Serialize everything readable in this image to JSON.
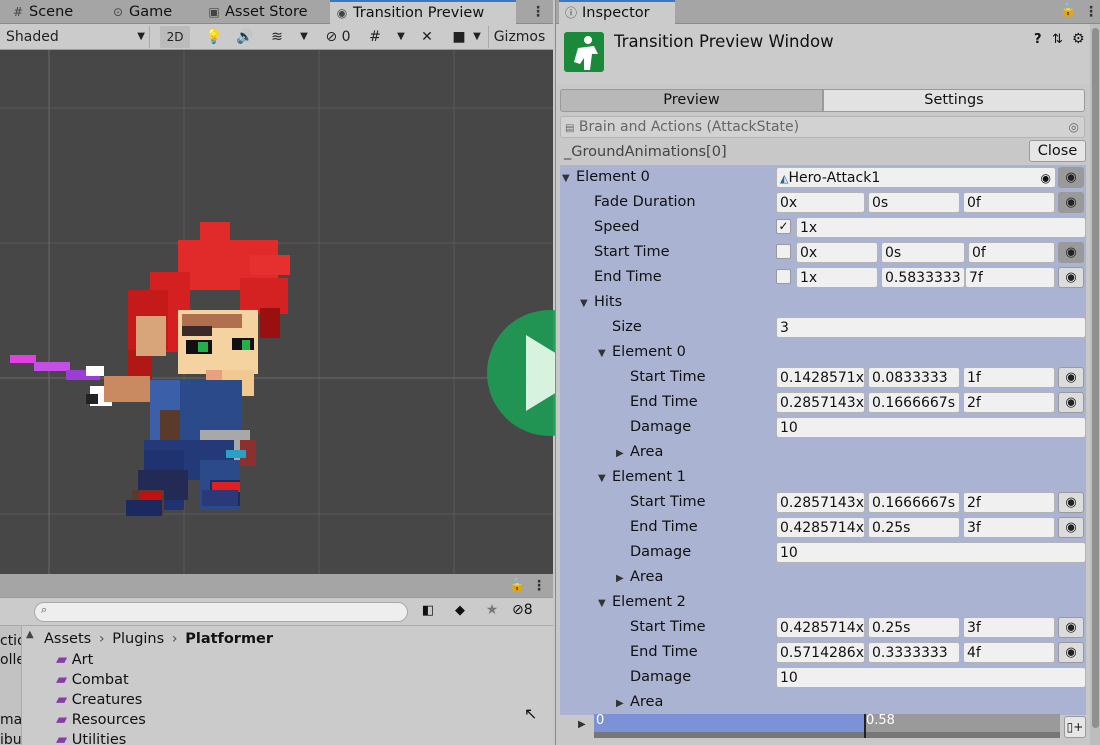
{
  "tabs": [
    {
      "label": "Scene",
      "icon": "grid-icon"
    },
    {
      "label": "Game",
      "icon": "gamepad-icon"
    },
    {
      "label": "Asset Store",
      "icon": "bag-icon"
    },
    {
      "label": "Transition Preview",
      "icon": "eye-icon"
    }
  ],
  "toolbar": {
    "shading_mode": "Shaded",
    "mode_2d": "2D",
    "hidden_count": "0",
    "gizmos": "Gizmos"
  },
  "project": {
    "search_placeholder": "",
    "hidden_count": "8",
    "breadcrumb": [
      "Assets",
      "Plugins",
      "Platformer"
    ],
    "folders": [
      "Art",
      "Combat",
      "Creatures",
      "Resources",
      "Utilities"
    ],
    "left_partial": [
      "ctio",
      "olle",
      "ma",
      "ibu"
    ]
  },
  "inspector": {
    "tab_label": "Inspector",
    "title": "Transition Preview Window",
    "subtabs": [
      "Preview",
      "Settings"
    ],
    "object_field": "Brain and Actions (AttackState)",
    "ground_animations": "_GroundAnimations[0]",
    "close": "Close",
    "element0": {
      "label": "Element 0",
      "clip": "Hero-Attack1",
      "fade_label": "Fade Duration",
      "fade": [
        "0x",
        "0s",
        "0f"
      ],
      "speed_label": "Speed",
      "speed_checked": "✓",
      "speed": "1x",
      "start_label": "Start Time",
      "start": [
        "0x",
        "0s",
        "0f"
      ],
      "end_label": "End Time",
      "end": [
        "1x",
        "0.5833333",
        "7f"
      ]
    },
    "hits": {
      "label": "Hits",
      "size_label": "Size",
      "size": "3",
      "start_label": "Start Time",
      "end_label": "End Time",
      "damage_label": "Damage",
      "area_label": "Area",
      "elements": [
        {
          "label": "Element 0",
          "start": [
            "0.1428571x",
            "0.0833333",
            "1f"
          ],
          "end": [
            "0.2857143x",
            "0.1666667s",
            "2f"
          ],
          "damage": "10"
        },
        {
          "label": "Element 1",
          "start": [
            "0.2857143x",
            "0.1666667s",
            "2f"
          ],
          "end": [
            "0.4285714x",
            "0.25s",
            "3f"
          ],
          "damage": "10"
        },
        {
          "label": "Element 2",
          "start": [
            "0.4285714x",
            "0.25s",
            "3f"
          ],
          "end": [
            "0.5714286x",
            "0.3333333",
            "4f"
          ],
          "damage": "10"
        }
      ]
    },
    "timeline": {
      "start": "0",
      "current": "0.58",
      "progress_fraction": 0.58
    },
    "eye_symbol": "◉"
  },
  "colors": {
    "accent": "#3a79bb",
    "play_button": "#1e9a55",
    "hierarchy_bg": "#aab4d2",
    "timeline_fill": "#7b93d6"
  }
}
